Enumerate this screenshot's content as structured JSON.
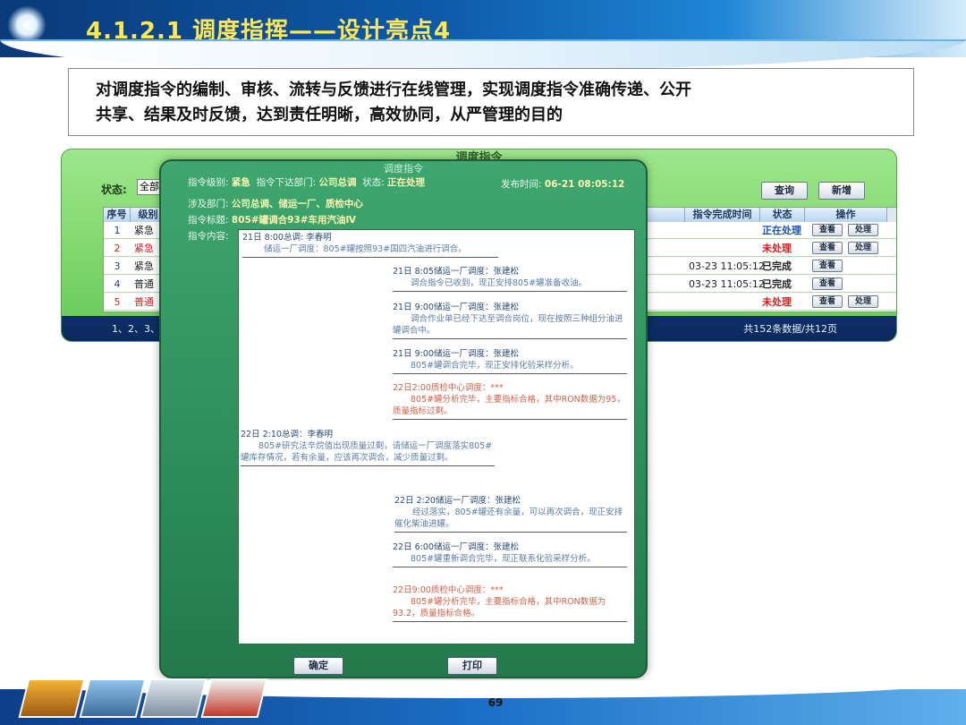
{
  "slide": {
    "title": "4.1.2.1 调度指挥——设计亮点4",
    "description_lines": [
      "对调度指令的编制、审核、流转与反馈进行在线管理，实现调度指令准确传递、公开",
      "共享、结果及时反馈，达到责任明晰，高效协同，从严管理的目的"
    ],
    "page_number": "69"
  },
  "list_window": {
    "title": "调度指令",
    "status_label": "状态:",
    "status_value": "全部",
    "query_button": "查询",
    "add_button": "新增",
    "headers": {
      "index": "序号",
      "level": "级别",
      "complete_time": "指令完成时间",
      "status": "状态",
      "action": "操作"
    },
    "rows": [
      {
        "index": "1",
        "level": "紧急",
        "complete_time": "",
        "status": "正在处理",
        "status_color": "#1a4fd0",
        "actions": [
          "查看",
          "处理"
        ]
      },
      {
        "index": "2",
        "level": "紧急",
        "complete_time": "",
        "status": "未处理",
        "status_color": "#d01f1f",
        "actions": [
          "查看",
          "处理"
        ]
      },
      {
        "index": "3",
        "level": "紧急",
        "complete_time": "03-23 11:05:12",
        "status": "已完成",
        "status_color": "#222222",
        "actions": [
          "查看"
        ]
      },
      {
        "index": "4",
        "level": "普通",
        "complete_time": "03-23 11:05:12",
        "status": "已完成",
        "status_color": "#222222",
        "actions": [
          "查看"
        ]
      },
      {
        "index": "5",
        "level": "普通",
        "complete_time": "",
        "status": "未处理",
        "status_color": "#d01f1f",
        "actions": [
          "查看",
          "处理"
        ]
      }
    ],
    "pager_left": "1、2、3、",
    "pager_right": "共152条数据/共12页"
  },
  "dialog": {
    "title": "调度指令",
    "level_label": "指令级别:",
    "level_value": "紧急",
    "dept_label": "指令下达部门:",
    "dept_value": "公司总调",
    "state_label": "状态:",
    "state_value": "正在处理",
    "time_label": "发布时间:",
    "time_value": "06-21 08:05:12",
    "involved_label": "涉及部门:",
    "involved_value": "公司总调、储运一厂、质检中心",
    "subject_label": "指令标题:",
    "subject_value": "805#罐调合93#车用汽油Ⅳ",
    "content_label": "指令内容:",
    "messages": [
      {
        "head": "21日  8:00总调:  李春明",
        "body": "储运一厂调度：805#罐按照93#国四汽油进行调合。"
      },
      {
        "head": "21日  8:05储运一厂调度：张建松",
        "body": "调合指令已收到，现正安排805#罐准备收油。"
      },
      {
        "head": "21日  9:00储运一厂调度：张建松",
        "body": "调合作业单已经下达至调合岗位，现在按照三种组分油进罐调合中。"
      },
      {
        "head": "21日  9:00储运一厂调度：张建松",
        "body": "805#罐调合完毕，现正安排化验采样分析。"
      },
      {
        "head": "22日2:00质检中心调度：***",
        "body": "805#罐分析完毕，主要指标合格，其中RON数据为95，质量指标过剩。"
      },
      {
        "head": "22日    2:10总调：李春明",
        "body": "805#研究法辛烷值出现质量过剩，请储运一厂调度落实805#罐库存情况，若有余量，应该再次调合，减少质量过剩。"
      },
      {
        "head": "22日  2:20储运一厂调度：张建松",
        "body": "经过落实，805#罐还有余量，可以再次调合，现正安排催化柴油进罐。"
      },
      {
        "head": "22日  6:00储运一厂调度：张建松",
        "body": "805#罐重新调合完毕，现正联系化验采样分析。"
      },
      {
        "head": "22日9:00质检中心调度：***",
        "body": "805#罐分析完毕，主要指标合格，其中RON数据为93.2，质量指标合格。"
      }
    ],
    "confirm_button": "确定",
    "print_button": "打印"
  },
  "colors": {
    "title_yellow": "#ffe75a",
    "banner_blue": "#0d5aa8",
    "list_green": "#7dd56a",
    "dialog_green": "#2e8f5c",
    "message_blue": "#5a7da8",
    "message_red": "#d2624a"
  }
}
